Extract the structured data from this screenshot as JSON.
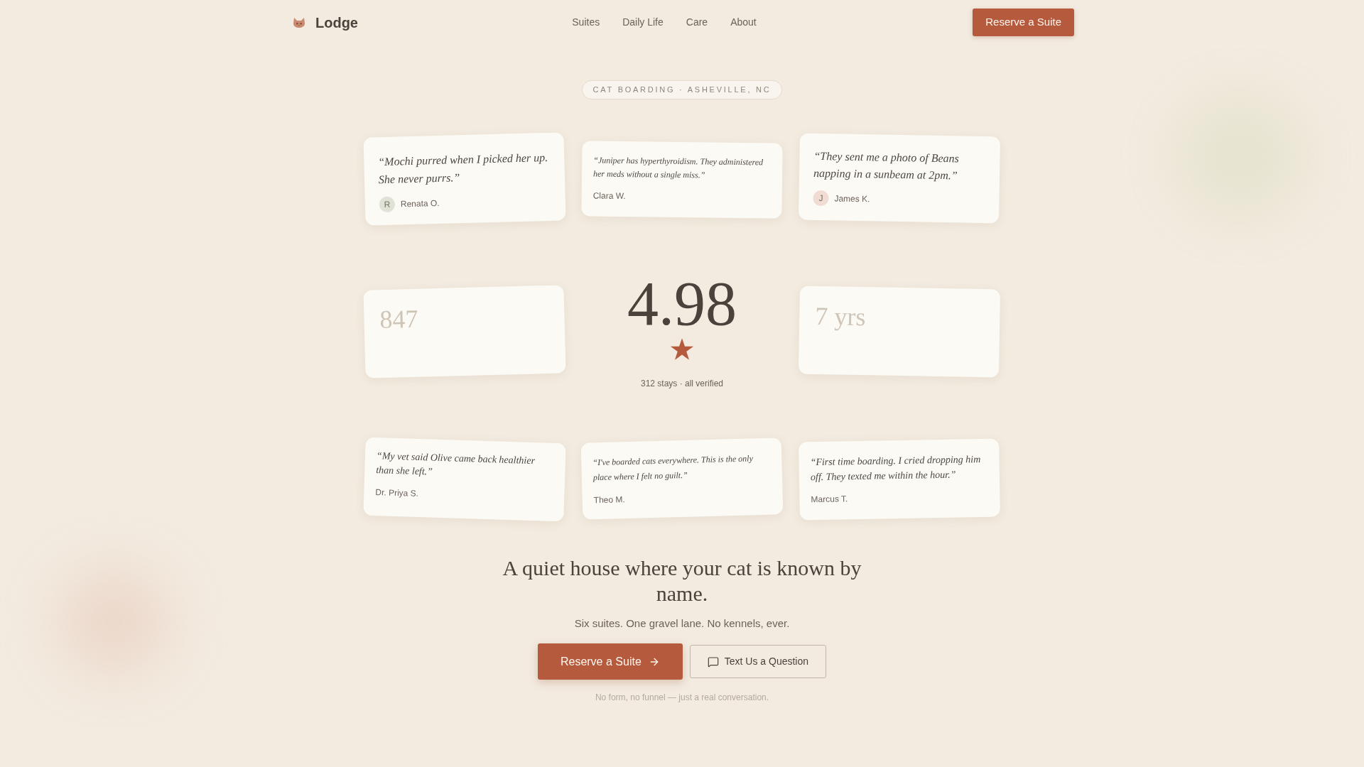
{
  "header": {
    "brand": "Lodge",
    "nav": [
      {
        "label": "Suites"
      },
      {
        "label": "Daily Life"
      },
      {
        "label": "Care"
      },
      {
        "label": "About"
      }
    ],
    "cta": "Reserve a Suite"
  },
  "badge": "CAT BOARDING · ASHEVILLE, NC",
  "testimonials_top": [
    {
      "quote": "“Mochi purred when I picked her up. She never purrs.”",
      "name": "Renata O.",
      "avatar": {
        "letter": "R",
        "color": "#dfe3d6"
      }
    },
    {
      "quote": "“Juniper has hyperthyroidism. They administered her meds without a single miss.”",
      "name": "Clara W."
    },
    {
      "quote": "“They sent me a photo of Beans napping in a sunbeam at 2pm.”",
      "name": "James K.",
      "avatar": {
        "letter": "J",
        "color": "#f1dcd3"
      }
    }
  ],
  "stats_row": {
    "left_stat": {
      "value": "847"
    },
    "rating": {
      "score": "4.98",
      "caption": "312 stays · all verified"
    },
    "right_stat": {
      "value": "7 yrs"
    }
  },
  "testimonials_bottom": [
    {
      "quote": "“My vet said Olive came back healthier than she left.”",
      "name": "Dr. Priya S."
    },
    {
      "quote": "“I've boarded cats everywhere. This is the only place where I felt no guilt.”",
      "name": "Theo M."
    },
    {
      "quote": "“First time boarding. I cried dropping him off. They texted me within the hour.”",
      "name": "Marcus T."
    }
  ],
  "hero": {
    "heading": "A quiet house where your cat is known by name.",
    "subheading": "Six suites. One gravel lane. No kennels, ever.",
    "buttons": [
      {
        "kind": "primary",
        "label": "Reserve a Suite"
      },
      {
        "kind": "secondary",
        "label": "Text Us a Question"
      }
    ],
    "note": "No form, no funnel — just a real conversation."
  }
}
